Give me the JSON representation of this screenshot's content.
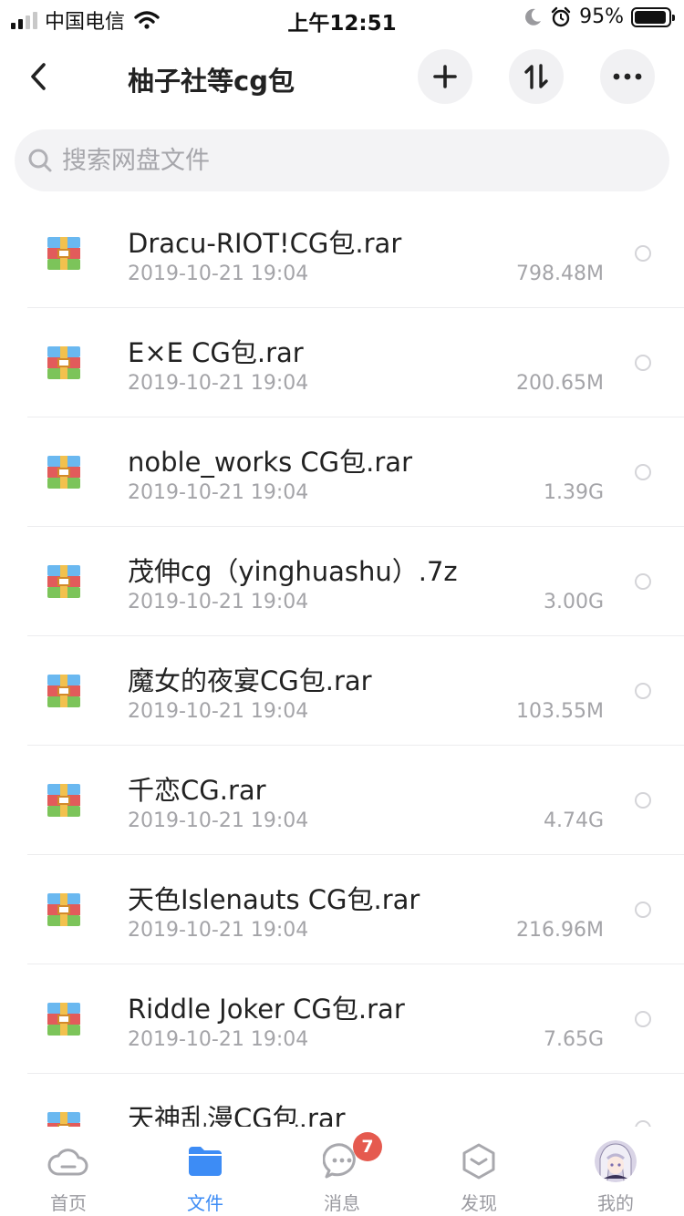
{
  "status_bar": {
    "carrier": "中国电信",
    "time": "上午12:51",
    "battery": "95%",
    "battery_level": 0.95
  },
  "header": {
    "title": "柚子社等cg包",
    "icons": [
      "back-arrow-icon",
      "plus-icon",
      "sort-icon",
      "more-icon"
    ]
  },
  "search": {
    "placeholder": "搜索网盘文件"
  },
  "files": [
    {
      "name": "Dracu-RIOT!CG包.rar",
      "date": "2019-10-21 19:04",
      "size": "798.48M"
    },
    {
      "name": "E×E CG包.rar",
      "date": "2019-10-21 19:04",
      "size": "200.65M"
    },
    {
      "name": "noble_works CG包.rar",
      "date": "2019-10-21 19:04",
      "size": "1.39G"
    },
    {
      "name": "茂伸cg（yinghuashu）.7z",
      "date": "2019-10-21 19:04",
      "size": "3.00G"
    },
    {
      "name": "魔女的夜宴CG包.rar",
      "date": "2019-10-21 19:04",
      "size": "103.55M"
    },
    {
      "name": "千恋CG.rar",
      "date": "2019-10-21 19:04",
      "size": "4.74G"
    },
    {
      "name": "天色Islenauts CG包.rar",
      "date": "2019-10-21 19:04",
      "size": "216.96M"
    },
    {
      "name": "Riddle Joker CG包.rar",
      "date": "2019-10-21 19:04",
      "size": "7.65G"
    },
    {
      "name": "天神乱漫CG包.rar",
      "date": "",
      "size": ""
    }
  ],
  "tabbar": {
    "items": [
      {
        "label": "首页",
        "icon": "cloud-icon"
      },
      {
        "label": "文件",
        "icon": "folder-icon"
      },
      {
        "label": "消息",
        "icon": "chat-icon",
        "badge": "7"
      },
      {
        "label": "发现",
        "icon": "discover-icon"
      },
      {
        "label": "我的",
        "icon": "avatar"
      }
    ]
  },
  "colors": {
    "accent": "#3d8cf5",
    "badge": "#e55a4f",
    "secondary_text": "#a4a4a8"
  }
}
